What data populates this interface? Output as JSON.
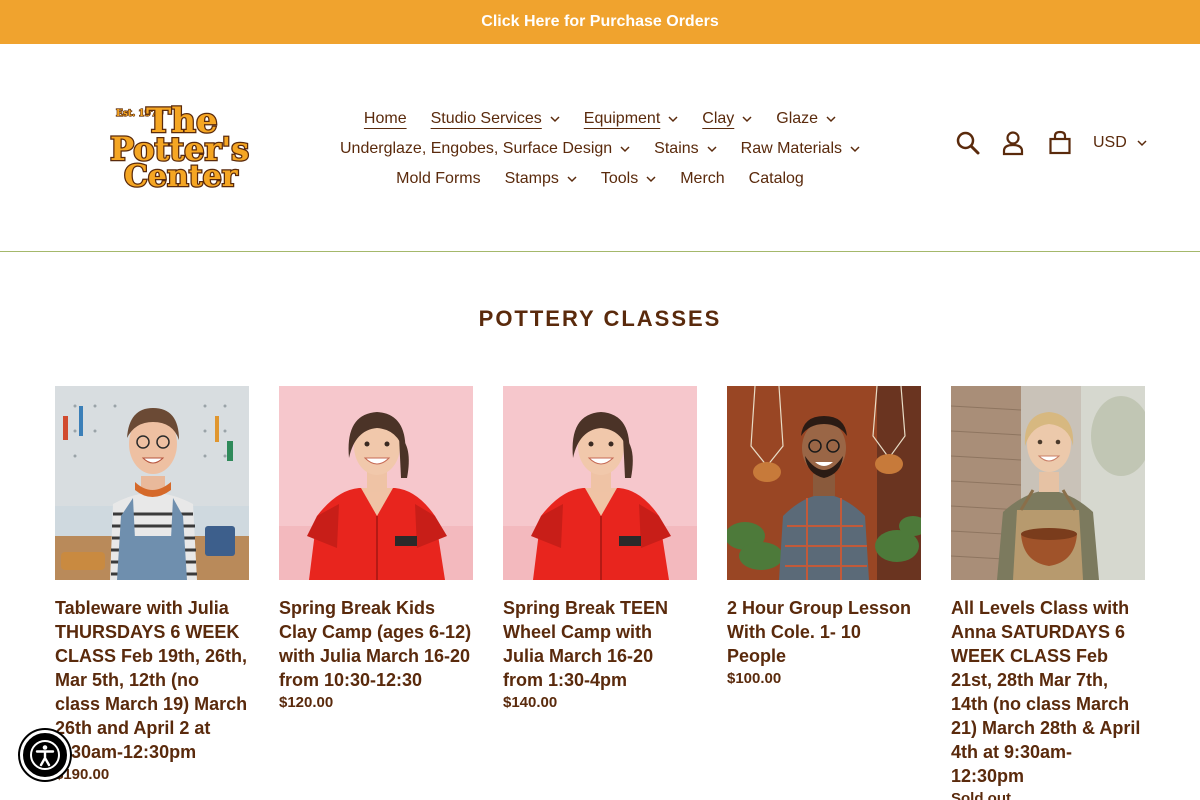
{
  "announcement": {
    "text": "Click Here for Purchase Orders"
  },
  "logo": {
    "text": "The Potter's Center",
    "est": "Est. 1970"
  },
  "nav": {
    "row1": [
      {
        "label": "Home",
        "dropdown": false,
        "active": true
      },
      {
        "label": "Studio Services",
        "dropdown": true
      },
      {
        "label": "Equipment",
        "dropdown": true
      },
      {
        "label": "Clay",
        "dropdown": true
      },
      {
        "label": "Glaze",
        "dropdown": true
      }
    ],
    "row2": [
      {
        "label": "Underglaze, Engobes, Surface Design",
        "dropdown": true
      },
      {
        "label": "Stains",
        "dropdown": true
      },
      {
        "label": "Raw Materials",
        "dropdown": true
      }
    ],
    "row3": [
      {
        "label": "Mold Forms",
        "dropdown": false
      },
      {
        "label": "Stamps",
        "dropdown": true
      },
      {
        "label": "Tools",
        "dropdown": true
      },
      {
        "label": "Merch",
        "dropdown": false
      },
      {
        "label": "Catalog",
        "dropdown": false
      }
    ]
  },
  "header_icons": [
    "search-icon",
    "account-icon",
    "cart-icon"
  ],
  "currency": {
    "selected": "USD"
  },
  "collection": {
    "title": "POTTERY CLASSES"
  },
  "products": [
    {
      "title": "Tableware with Julia THURSDAYS 6 WEEK CLASS Feb 19th, 26th, Mar 5th, 12th (no class March 19) March 26th and April 2 at 9:30am-12:30pm",
      "price": "$190.00",
      "image": "woman-overalls-pegboard"
    },
    {
      "title": "Spring Break Kids Clay Camp (ages 6-12) with Julia March 16-20 from 10:30-12:30",
      "price": "$120.00",
      "image": "woman-red-jumpsuit"
    },
    {
      "title": "Spring Break TEEN Wheel Camp with Julia March 16-20 from 1:30-4pm",
      "price": "$140.00",
      "image": "woman-red-jumpsuit"
    },
    {
      "title": "2 Hour Group Lesson With Cole. 1- 10 People",
      "price": "$100.00",
      "image": "man-plaid-shirt-plants"
    },
    {
      "title": "All Levels Class with Anna SATURDAYS 6 WEEK CLASS Feb 21st, 28th Mar 7th, 14th (no class March 21) March 28th & April 4th at 9:30am-12:30pm",
      "price": "Sold out",
      "image": "woman-apron-bowl"
    }
  ],
  "colors": {
    "accent": "#f0a32e",
    "brand": "#5a2a0c",
    "divider": "#a4b86b"
  }
}
